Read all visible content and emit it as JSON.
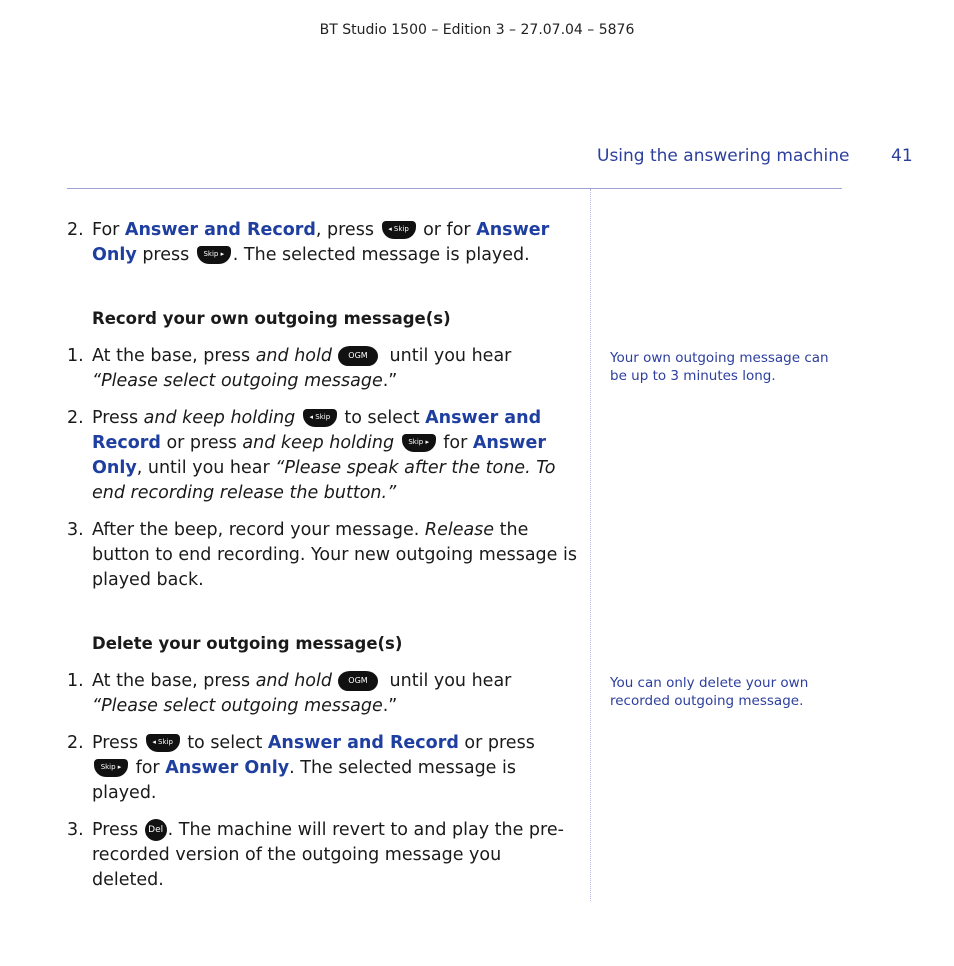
{
  "header": {
    "doc_id": "BT Studio 1500 – Edition 3 – 27.07.04 – 5876",
    "section_title": "Using the answering machine",
    "page_number": "41"
  },
  "keys": {
    "skip_back": "◂ Skip",
    "skip_fwd": "Skip ▸",
    "ogm": "OGM",
    "del": "Del"
  },
  "intro_step": {
    "num": "2.",
    "t1": "For ",
    "b1": "Answer and Record",
    "t2": ", press ",
    "t3": " or for ",
    "b2": "Answer Only",
    "t4": " press ",
    "t5": ". The selected message is played."
  },
  "record_section": {
    "heading": "Record your own outgoing message(s)",
    "steps": [
      {
        "num": "1.",
        "t1": "At the base, press ",
        "i1": "and hold",
        "t2": " until you hear ",
        "i2": "“Please select outgoing message",
        "t3": ".”"
      },
      {
        "num": "2.",
        "t1": "Press ",
        "i1": "and keep holding",
        "t2": " to select ",
        "b1": "Answer and Record",
        "t3": " or press ",
        "i2": "and keep holding",
        "t4": " for ",
        "b2": "Answer Only",
        "t5": ", until you hear ",
        "i3": "“Please speak after the tone. To end recording release the button.”"
      },
      {
        "num": "3.",
        "t1": "After the beep, record your message. ",
        "i1": "Release",
        "t2": " the button to end recording. Your new outgoing message is played back."
      }
    ],
    "note": "Your own outgoing message can be up to 3 minutes long."
  },
  "delete_section": {
    "heading": "Delete your outgoing message(s)",
    "steps": [
      {
        "num": "1.",
        "t1": "At the base, press ",
        "i1": "and hold",
        "t2": " until you hear ",
        "i2": "“Please select outgoing message",
        "t3": ".”"
      },
      {
        "num": "2.",
        "t1": "Press ",
        "t2": " to select ",
        "b1": "Answer and Record",
        "t3": " or press ",
        "t4": " for ",
        "b2": "Answer Only",
        "t5": ". The selected message is played."
      },
      {
        "num": "3.",
        "t1": "Press ",
        "t2": ". The machine will revert to and play the pre-recorded version of the outgoing message you deleted."
      }
    ],
    "note": "You can only delete your own recorded outgoing message."
  }
}
